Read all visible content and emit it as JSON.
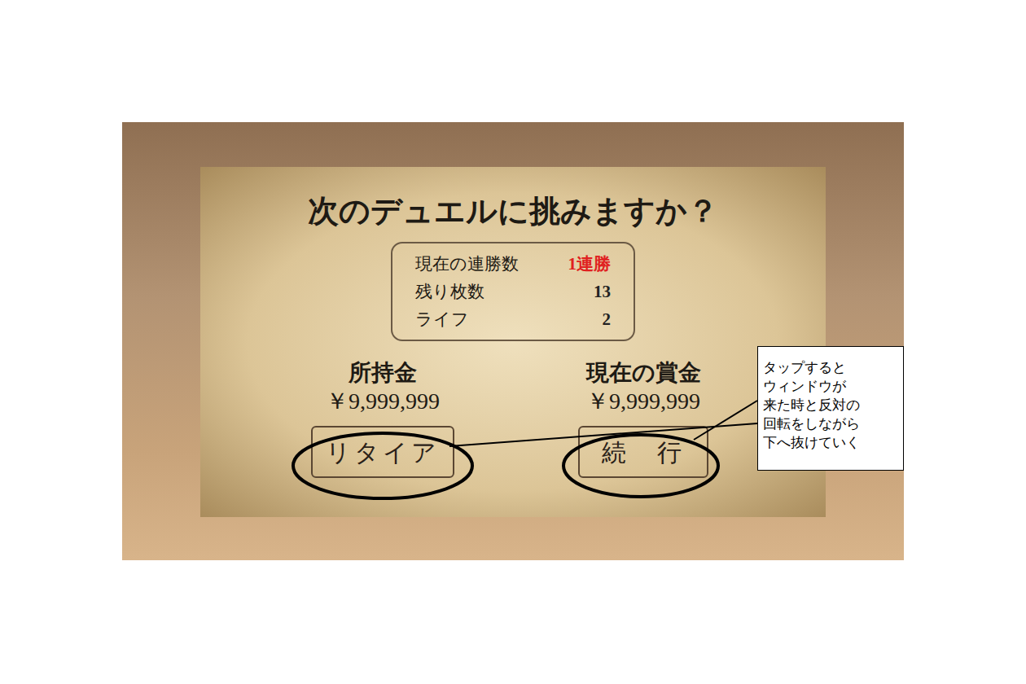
{
  "dialog": {
    "title": "次のデュエルに挑みますか？",
    "stats": [
      {
        "label": "現在の連勝数",
        "value": "1連勝",
        "color": "#e02020"
      },
      {
        "label": "残り枚数",
        "value": "13",
        "color": "#222222"
      },
      {
        "label": "ライフ",
        "value": "2",
        "color": "#222222"
      }
    ],
    "money": [
      {
        "label": "所持金",
        "value": "￥9,999,999"
      },
      {
        "label": "現在の賞金",
        "value": "￥9,999,999"
      }
    ],
    "buttons": [
      "リタイア",
      "続　行"
    ]
  },
  "annotation": {
    "lines": [
      "タップすると",
      "ウィンドウが",
      "来た時と反対の",
      "回転をしながら",
      "下へ抜けていく"
    ]
  }
}
